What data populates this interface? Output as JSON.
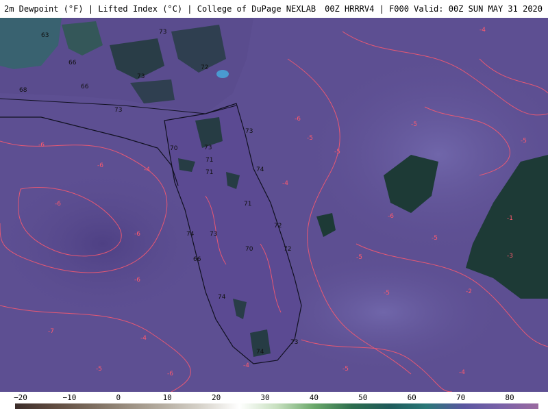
{
  "header": {
    "left_text": "2m Dewpoint (°F) | Lifted Index (°C) | College of DuPage NEXLAB",
    "right_text": "00Z HRRRV4 | F000 Valid: 00Z SUN MAY 31 2020"
  },
  "colors": {
    "background_purple": "#5d4f92",
    "deep_ocean_purple": "#53458a",
    "light_ocean_purple": "#6a5fa4",
    "land_dark_green": "#1d3a36",
    "contour_red": "#ff5a6e",
    "coastline": "#101020"
  },
  "map_labels": {
    "dewpoint_labels": [
      "63",
      "66",
      "73",
      "68",
      "72",
      "66",
      "73",
      "73",
      "73",
      "73",
      "70",
      "73",
      "71",
      "71",
      "74",
      "72",
      "70",
      "72",
      "74",
      "66",
      "74",
      "73",
      "74",
      "71"
    ],
    "lifted_index_labels": [
      "-6",
      "-6",
      "-4",
      "-6",
      "-6",
      "-6",
      "-7",
      "-6",
      "-4",
      "-5",
      "-5",
      "-5",
      "-4",
      "-5",
      "-6",
      "-5",
      "-5",
      "-5",
      "-4",
      "-4",
      "-5",
      "-1",
      "-2",
      "-3",
      "-4",
      "-5",
      "-6"
    ]
  },
  "colorbar": {
    "ticks": [
      "−20",
      "−10",
      "0",
      "10",
      "20",
      "30",
      "40",
      "50",
      "60",
      "70",
      "80"
    ],
    "gradient_stops": [
      "#3b2d2a",
      "#5e4a3f",
      "#7a6a5c",
      "#9a8e80",
      "#b8b0a4",
      "#d8d4cc",
      "#ffffff",
      "#c8e0c0",
      "#6aa86a",
      "#2e6e4e",
      "#1f5a5a",
      "#2a7878",
      "#5a56a0",
      "#7a62a8",
      "#9a6aa0"
    ]
  }
}
